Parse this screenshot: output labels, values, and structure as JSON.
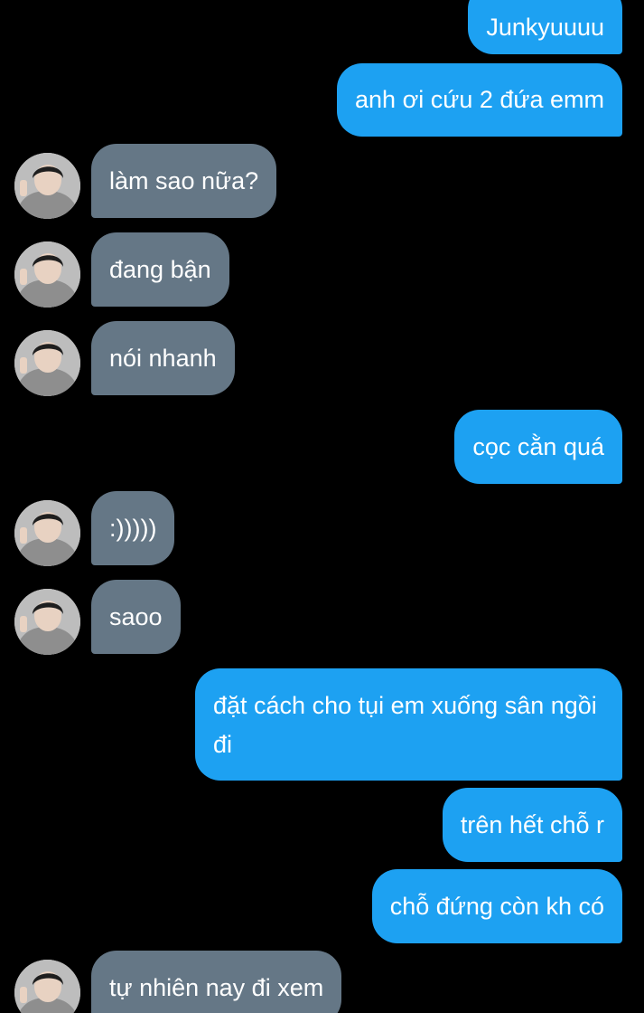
{
  "conversation": {
    "messages": [
      {
        "side": "out",
        "text": "Junkyuuuu"
      },
      {
        "side": "out",
        "text": "anh ơi cứu 2 đứa emm"
      },
      {
        "side": "in",
        "text": "làm sao nữa?"
      },
      {
        "side": "in",
        "text": "đang bận"
      },
      {
        "side": "in",
        "text": "nói nhanh"
      },
      {
        "side": "out",
        "text": "cọc cằn quá"
      },
      {
        "side": "in",
        "text": ":)))))"
      },
      {
        "side": "in",
        "text": "saoo"
      },
      {
        "side": "out",
        "text": "đặt cách cho tụi em xuống sân ngồi đi"
      },
      {
        "side": "out",
        "text": "trên hết chỗ r"
      },
      {
        "side": "out",
        "text": "chỗ đứng còn kh có"
      },
      {
        "side": "in",
        "text": "tự nhiên nay đi xem"
      }
    ]
  },
  "colors": {
    "background": "#000000",
    "outgoing_bubble": "#1da1f2",
    "incoming_bubble": "#657786",
    "text": "#ffffff"
  },
  "icons": {
    "avatar": "contact-avatar-photo"
  }
}
